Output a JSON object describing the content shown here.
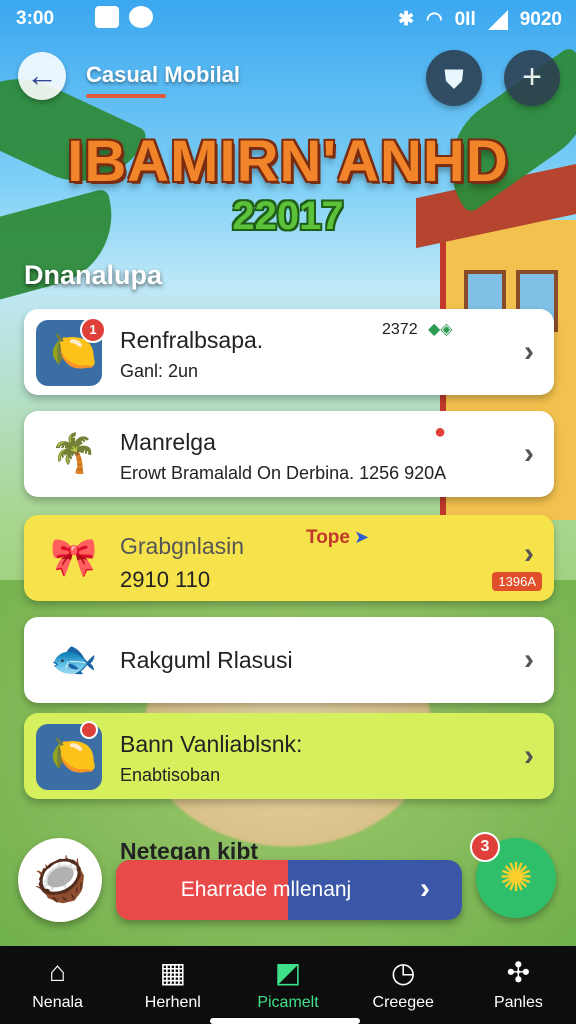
{
  "status_bar": {
    "time": "3:00",
    "network": "0Il",
    "right_text": "9020"
  },
  "header": {
    "title": "Casual Mobilal",
    "back_icon": "arrow-left-icon",
    "shield_icon": "shield-icon",
    "add_icon": "plus-icon"
  },
  "logo": {
    "main": "IBAMIRN'ANHD",
    "year": "22017"
  },
  "section_title": "Dnanalupa",
  "cards": [
    {
      "title": "Renfralbsapa.",
      "subtitle": "Ganl: 2un",
      "meta": "2372",
      "badge": "1",
      "icon": "fruit-character-icon"
    },
    {
      "title": "Manrelga",
      "subtitle": "Erowt Bramalald On Derbina. 1256 920A",
      "icon": "palm-tree-icon",
      "pin_icon": "map-pin-icon"
    },
    {
      "title": "Grabgnlasin",
      "subtitle": "2910 110",
      "tag": "Tope",
      "corner_tag": "1396A",
      "icon": "bow-character-icon"
    },
    {
      "title": "Rakguml Rlasusi",
      "icon": "fish-icon"
    },
    {
      "title": "Bann Vanliablsnk:",
      "subtitle": "Enabtisoban",
      "badge": "",
      "icon": "fruit-character-icon"
    }
  ],
  "partial_text": "Netegan kibt",
  "cta": {
    "label": "Eharrade mllenanj"
  },
  "sun_badge": "3",
  "bottom_nav": [
    {
      "label": "Nenala",
      "icon": "home-icon"
    },
    {
      "label": "Herhenl",
      "icon": "shop-icon"
    },
    {
      "label": "Picamelt",
      "icon": "map-icon",
      "active": true
    },
    {
      "label": "Creegee",
      "icon": "clock-icon"
    },
    {
      "label": "Panles",
      "icon": "puzzle-icon"
    }
  ],
  "colors": {
    "accent_green": "#3ee08a",
    "cta_red": "#e84a4a",
    "cta_blue": "#3a56a6"
  }
}
